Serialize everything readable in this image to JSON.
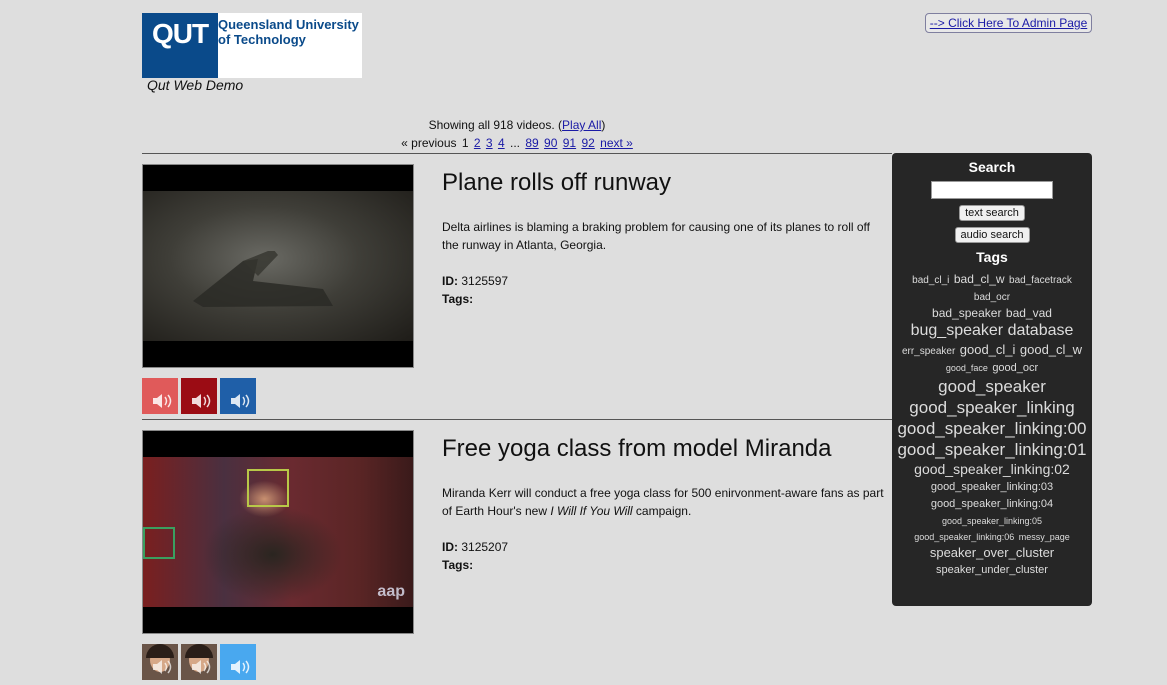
{
  "header": {
    "logo_mark": "QUT",
    "logo_line1": "Queensland University",
    "logo_line2": "of Technology",
    "site_title": "Qut Web Demo",
    "admin_link": "--> Click Here To Admin Page"
  },
  "listing": {
    "summary_prefix": "Showing all 918 videos. (",
    "play_all": "Play All",
    "summary_suffix": ")",
    "pager": {
      "previous": "« previous",
      "current": "1",
      "pages_a": [
        "2",
        "3",
        "4"
      ],
      "ellipsis": "...",
      "pages_b": [
        "89",
        "90",
        "91",
        "92"
      ],
      "next": "next »"
    }
  },
  "videos": [
    {
      "title": "Plane rolls off runway",
      "description": "Delta airlines is blaming a braking problem for causing one of its planes to roll off the runway in Atlanta, Georgia.",
      "id_label": "ID:",
      "id": "3125597",
      "tags_label": "Tags:"
    },
    {
      "title": "Free yoga class from model Miranda",
      "description_a": "Miranda Kerr will conduct a free yoga class for 500 enirvonment-aware fans as part of Earth Hour's new ",
      "description_em": "I Will If You Will",
      "description_b": " campaign.",
      "id_label": "ID:",
      "id": "3125207",
      "tags_label": "Tags:",
      "watermark": "aap"
    }
  ],
  "sidebar": {
    "search_heading": "Search",
    "search_value": "",
    "text_search": "text search",
    "audio_search": "audio search",
    "tags_heading": "Tags",
    "tags": [
      "bad_cl_i",
      "bad_cl_w",
      "bad_facetrack",
      "bad_ocr",
      "bad_speaker",
      "bad_vad",
      "bug_speaker",
      "database",
      "err_speaker",
      "good_cl_i",
      "good_cl_w",
      "good_face",
      "good_ocr",
      "good_speaker",
      "good_speaker_linking",
      "good_speaker_linking:00",
      "good_speaker_linking:01",
      "good_speaker_linking:02",
      "good_speaker_linking:03",
      "good_speaker_linking:04",
      "good_speaker_linking:05",
      "good_speaker_linking:06",
      "messy_page",
      "speaker_over_cluster",
      "speaker_under_cluster"
    ]
  },
  "colors": {
    "page_bg": "#dedede",
    "sidebar_bg": "#262626",
    "qut_blue": "#0a4a8a",
    "audio_red_light": "#e05a5a",
    "audio_red_dark": "#9b0c14",
    "audio_blue": "#1f5fa8",
    "audio_blue_light": "#49a8ef"
  },
  "icons": [
    "speaker-icon"
  ]
}
